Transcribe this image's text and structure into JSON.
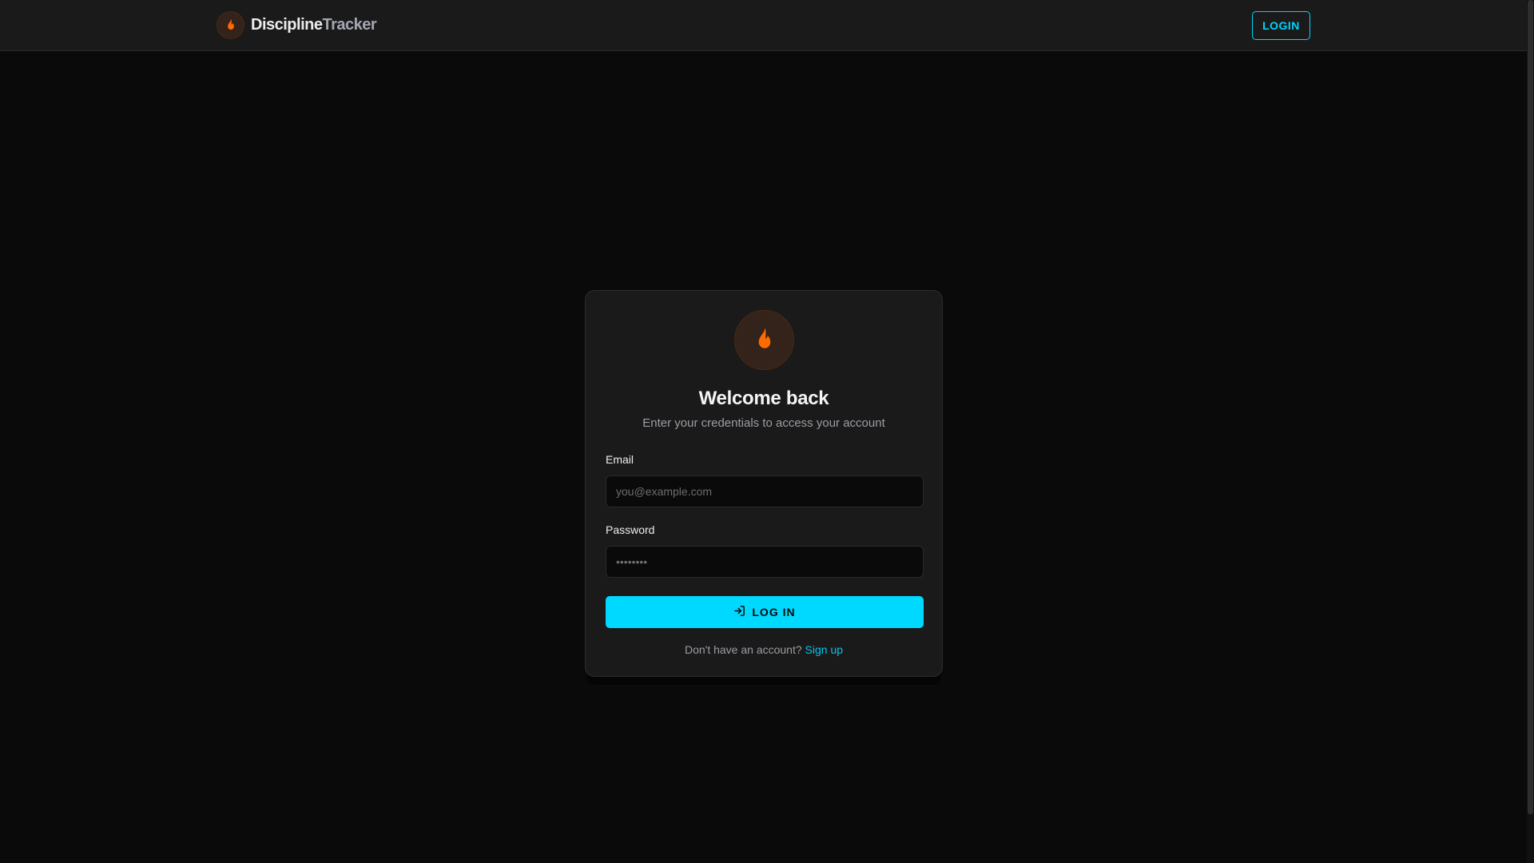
{
  "header": {
    "brand_part1": "Discipline",
    "brand_part2": "Tracker",
    "login_label": "LOGIN"
  },
  "card": {
    "title": "Welcome back",
    "subtitle": "Enter your credentials to access your account",
    "email_label": "Email",
    "email_placeholder": "you@example.com",
    "email_value": "",
    "password_label": "Password",
    "password_placeholder": "••••••••",
    "submit_label": "LOG IN",
    "footer_text": "Don't have an account?",
    "signup_link": "Sign up"
  },
  "colors": {
    "accent": "#00d9ff",
    "flame": "#ff6a00",
    "background": "#0a0a0a",
    "card": "#1a1a1a"
  },
  "icons": {
    "logo": "flame-icon",
    "submit": "log-in-icon"
  }
}
